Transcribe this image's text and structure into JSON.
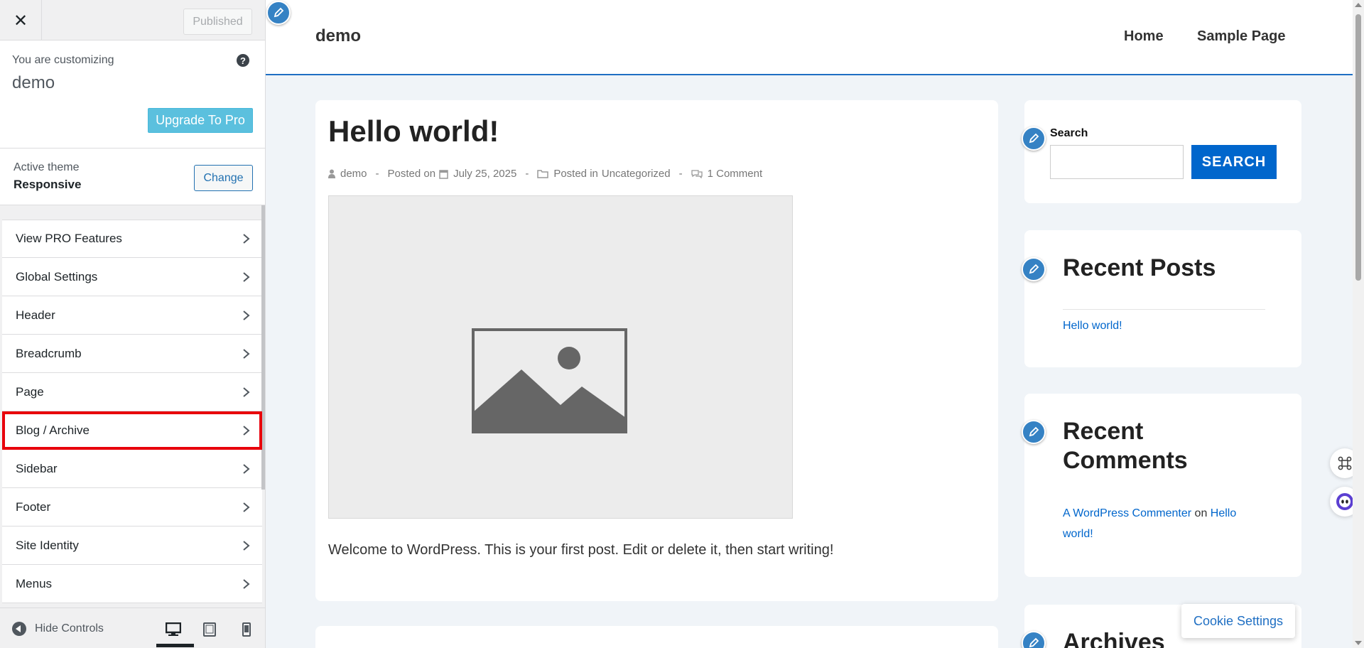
{
  "customizer": {
    "close_icon": "close-icon",
    "published_label": "Published",
    "customizing_label": "You are customizing",
    "site_name": "demo",
    "help_icon_text": "?",
    "upgrade_label": "Upgrade To Pro",
    "active_theme_label": "Active theme",
    "active_theme_name": "Responsive",
    "change_label": "Change",
    "menu_items": [
      {
        "label": "View PRO Features"
      },
      {
        "label": "Global Settings"
      },
      {
        "label": "Header"
      },
      {
        "label": "Breadcrumb"
      },
      {
        "label": "Page"
      },
      {
        "label": "Blog / Archive",
        "highlighted": true
      },
      {
        "label": "Sidebar"
      },
      {
        "label": "Footer"
      },
      {
        "label": "Site Identity"
      },
      {
        "label": "Menus"
      }
    ],
    "hide_controls_label": "Hide Controls",
    "devices": [
      "desktop",
      "tablet",
      "mobile"
    ],
    "active_device": "desktop",
    "highlight_color": "#e8000b"
  },
  "preview": {
    "site_title": "demo",
    "nav": [
      "Home",
      "Sample Page"
    ],
    "post": {
      "title": "Hello world!",
      "author": "demo",
      "posted_on_label": "Posted on",
      "date": "July 25, 2025",
      "posted_in_label": "Posted in",
      "category": "Uncategorized",
      "comments": "1 Comment",
      "excerpt": "Welcome to WordPress. This is your first post. Edit or delete it, then start writing!"
    },
    "search_widget": {
      "label": "Search",
      "input_value": "",
      "button_label": "SEARCH"
    },
    "recent_posts": {
      "title": "Recent Posts",
      "items": [
        "Hello world!"
      ]
    },
    "recent_comments": {
      "title_line1": "Recent",
      "title_line2": "Comments",
      "commenter": "A WordPress Commenter",
      "on_text": "on",
      "post_link_line1": "Hello",
      "post_link_line2": "world!"
    },
    "archives_title": "Archives",
    "cookie_label": "Cookie Settings",
    "accent_color": "#0066cc",
    "header_border_color": "#1f6fc3"
  }
}
